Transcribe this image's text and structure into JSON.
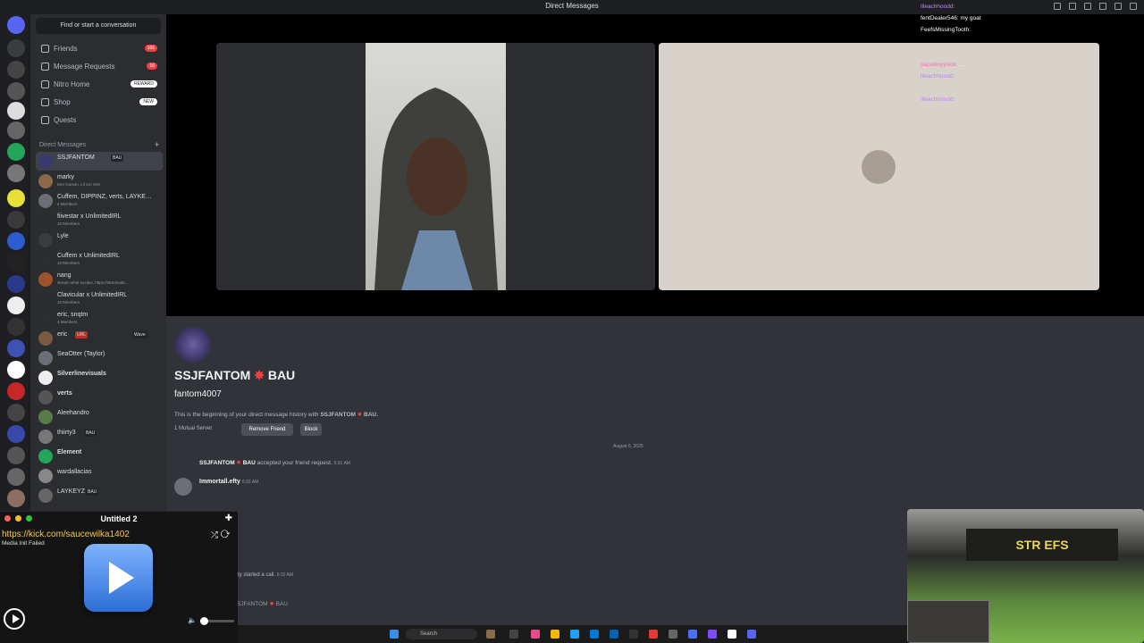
{
  "window": {
    "title": "Direct Messages"
  },
  "sidebar": {
    "find_label": "Find or start a conversation",
    "nav": [
      {
        "label": "Friends",
        "badge": "166"
      },
      {
        "label": "Message Requests",
        "badge": "16"
      },
      {
        "label": "Nitro Home",
        "pill": "REWARD"
      },
      {
        "label": "Shop",
        "pill": "NEW"
      },
      {
        "label": "Quests"
      }
    ],
    "dm_header": "Direct Messages",
    "dms": [
      {
        "name": "SSJFANTOM",
        "tag": "BAU",
        "sub": ""
      },
      {
        "name": "marky",
        "sub": "Ken Carson, Lil Uzi Vert"
      },
      {
        "name": "Cuffem, DIPPINZ, verts, LAYKE…",
        "sub": "6 Members"
      },
      {
        "name": "fiivestar x UnlimitedIRL",
        "sub": "10 Members"
      },
      {
        "name": "Lyle",
        "sub": ""
      },
      {
        "name": "Cuffem x UnlimitedIRL",
        "sub": "10 Members"
      },
      {
        "name": "nang",
        "sub": "stream what excites, https://streamabl…"
      },
      {
        "name": "Clavicular x UnlimitedIRL",
        "sub": "10 Members"
      },
      {
        "name": "eric, snqtm",
        "sub": "3 Members"
      },
      {
        "name": "eric",
        "tag": "URL",
        "wave": "Wave"
      },
      {
        "name": "SeaOtter (Taylor)",
        "sub": ""
      },
      {
        "name": "Silverlinevisuals",
        "sub": ""
      },
      {
        "name": "verts",
        "sub": ""
      },
      {
        "name": "Aleehandro",
        "sub": ""
      },
      {
        "name": "thiirty3",
        "tag": "BAU"
      },
      {
        "name": "Element",
        "sub": ""
      },
      {
        "name": "wardallacias",
        "sub": ""
      },
      {
        "name": "LAYKEYZ",
        "tag": "BAU"
      }
    ]
  },
  "overlay": {
    "lines": [
      {
        "user": "llleachhoodd:",
        "msg": ""
      },
      {
        "user": "fentDealer546:",
        "msg": "my goat"
      },
      {
        "user": "FeefsMissingTooth:",
        "msg": ""
      },
      {
        "user": "",
        "msg": ""
      },
      {
        "user": "",
        "msg": ""
      },
      {
        "user": "papeboyynick:",
        "msg": "…"
      },
      {
        "user": "llleachhoodd:",
        "msg": ""
      },
      {
        "user": "",
        "msg": ""
      },
      {
        "user": "llleachhoodd:",
        "msg": ""
      }
    ]
  },
  "profile": {
    "display_name": "SSJFANTOM",
    "tag": "BAU",
    "username": "fantom4007",
    "desc_prefix": "This is the beginning of your direct message history with",
    "desc_name": "SSJFANTOM",
    "desc_tag": "BAU.",
    "mutual": "1 Mutual Server",
    "remove_label": "Remove Friend",
    "block_label": "Block"
  },
  "messages": {
    "date": "August 6, 2025",
    "system1_name": "SSJFANTOM",
    "system1_tag": "BAU",
    "system1_text": "accepted your friend request.",
    "system1_time": "6:31 AM",
    "msg_author": "Immortall.efty",
    "msg_time": "6:32 AM",
    "system2_text": "ty started a call.",
    "system2_time": "6:32 AM",
    "composer": "SJFANTOM",
    "composer_tag": "BAU"
  },
  "player": {
    "title": "Untitled 2",
    "url": "https://kick.com/saucewilka1402",
    "error": "Media Init Failed"
  },
  "webcam": {
    "banner": "STR EFS"
  },
  "taskbar": {
    "search": "Search"
  },
  "colors": {
    "bg": "#1e1f22",
    "sidebar": "#2b2d31",
    "chat": "#313338",
    "accent": "#5865f2",
    "badge": "#f23f43"
  }
}
